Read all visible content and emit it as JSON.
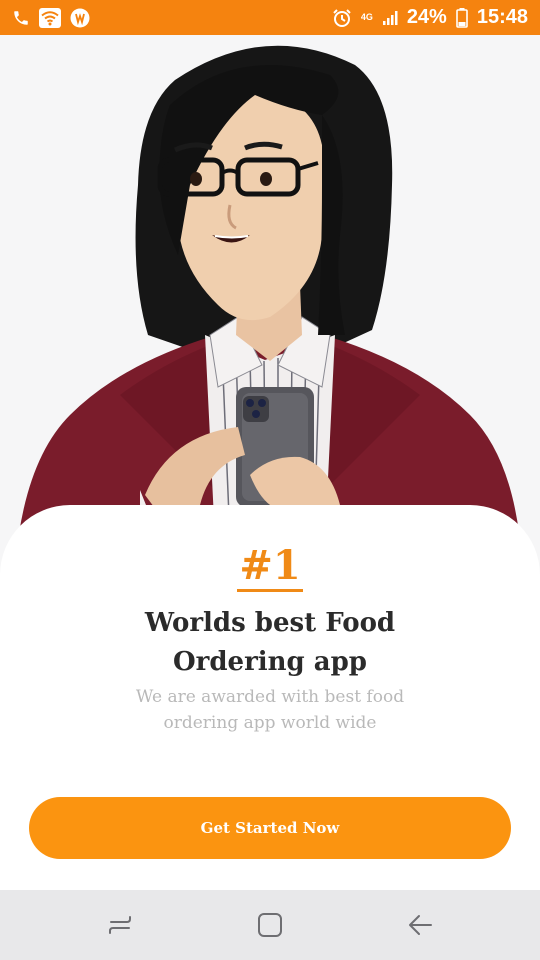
{
  "status_bar": {
    "network_type": "4G",
    "battery": "24%",
    "time": "15:48",
    "icons": [
      "phone-icon",
      "wifi-icon",
      "app-notification-icon",
      "alarm-icon",
      "signal-icon",
      "battery-icon"
    ]
  },
  "onboarding": {
    "rank": "#1",
    "title": "Worlds best Food Ordering app",
    "subtitle": "We are awarded with best food ordering app world wide",
    "cta_label": "Get Started Now"
  },
  "nav_bar": {
    "icons": [
      "recent-apps-icon",
      "home-icon",
      "back-icon"
    ]
  },
  "colors": {
    "status_bar": "#f5830f",
    "accent": "#f08a16",
    "button": "#fb9410",
    "title_text": "#2b2b2b",
    "subtitle_text": "#b9b9b9",
    "nav_bar": "#e8e8ea"
  }
}
